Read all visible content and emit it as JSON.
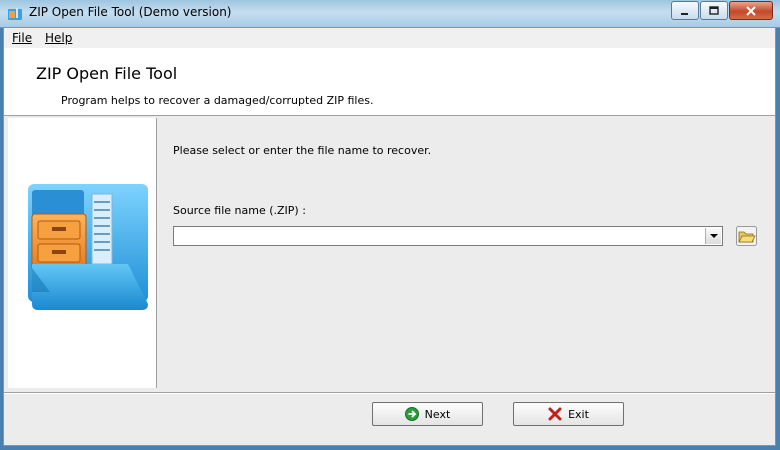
{
  "window": {
    "title": "ZIP Open File Tool (Demo version)",
    "controls": {
      "minimize": "minimize",
      "maximize": "maximize",
      "close": "close"
    }
  },
  "menu": {
    "file": "File",
    "help": "Help"
  },
  "header": {
    "title": "ZIP Open File Tool",
    "subtitle": "Program helps to recover a damaged/corrupted ZIP files."
  },
  "main": {
    "prompt": "Please select or enter the file name to recover.",
    "source_label": "Source file name (.ZIP) :",
    "source_value": ""
  },
  "buttons": {
    "next": "Next",
    "exit": "Exit"
  },
  "icons": {
    "app": "zip-folder-icon",
    "browse": "open-folder-icon",
    "next": "green-arrow-icon",
    "exit": "red-x-icon",
    "logo": "zip-folder-logo"
  },
  "colors": {
    "accent": "#4a7fae",
    "next_icon": "#2e9e3a",
    "exit_icon": "#c0201a"
  }
}
